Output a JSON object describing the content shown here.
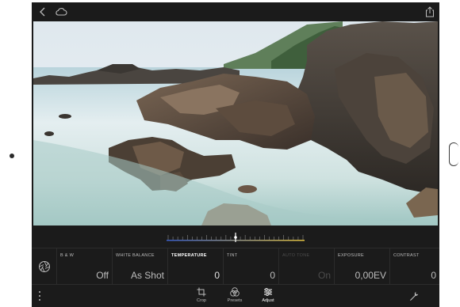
{
  "topbar": {
    "back_icon": "chevron-left-icon",
    "cloud_icon": "cloud-icon",
    "share_icon": "share-icon"
  },
  "slider": {
    "accent_left": "#3a5ec8",
    "accent_right": "#e0c040",
    "position_fraction": 0.5
  },
  "controls": {
    "panel_icon": "aperture-icon",
    "items": [
      {
        "label": "B & W",
        "value": "Off"
      },
      {
        "label": "WHITE BALANCE",
        "value": "As Shot"
      },
      {
        "label": "TEMPERATURE",
        "value": "0"
      },
      {
        "label": "TINT",
        "value": "0"
      },
      {
        "label": "AUTO TONE",
        "value": "On"
      },
      {
        "label": "EXPOSURE",
        "value": "0,00EV"
      },
      {
        "label": "CONTRAST",
        "value": "0"
      }
    ]
  },
  "toolbar": {
    "more_icon": "more-vertical-icon",
    "crop_label": "Crop",
    "presets_label": "Presets",
    "adjust_label": "Adjust",
    "settings_icon": "wrench-icon"
  }
}
